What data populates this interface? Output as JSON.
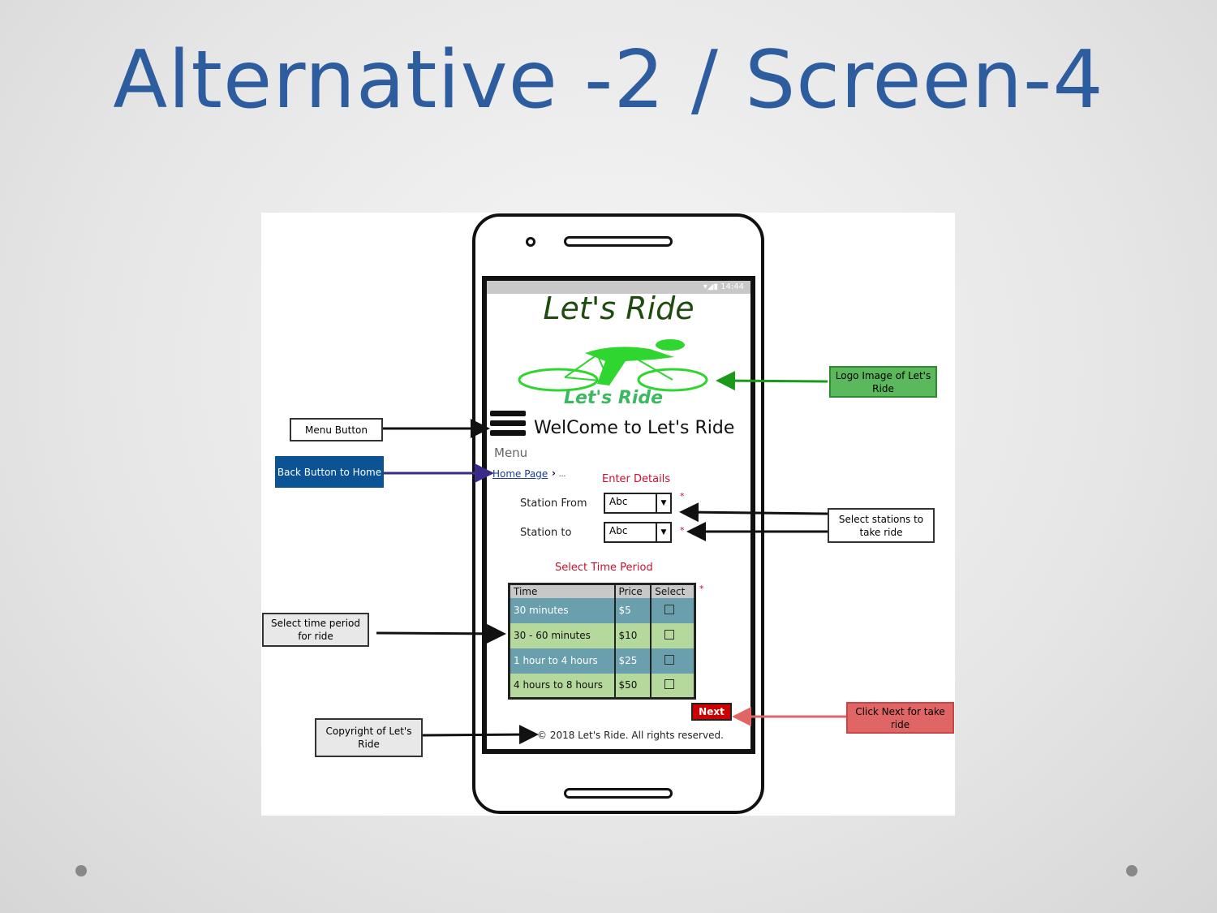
{
  "slide": {
    "title": "Alternative -2 / Screen-4"
  },
  "mockup": {
    "status_time": "14:44",
    "app_title": "Let's Ride",
    "logo_text": "Let's Ride",
    "welcome": "WelCome to Let's Ride",
    "menu_label": "Menu",
    "breadcrumb": {
      "home": "Home Page",
      "separator": "›",
      "ellipsis": "..."
    },
    "enter_details": "Enter Details",
    "station_from": {
      "label": "Station From",
      "value": "Abc"
    },
    "station_to": {
      "label": "Station to",
      "value": "Abc"
    },
    "required_mark": "*",
    "select_time_period": "Select Time Period",
    "table": {
      "headers": [
        "Time",
        "Price",
        "Select"
      ],
      "rows": [
        {
          "time": "30 minutes",
          "price": "$5"
        },
        {
          "time": "30 - 60 minutes",
          "price": "$10"
        },
        {
          "time": "1 hour to 4 hours",
          "price": "$25"
        },
        {
          "time": "4 hours to 8 hours",
          "price": "$50"
        }
      ]
    },
    "next": "Next",
    "copyright": "© 2018 Let's Ride. All rights reserved."
  },
  "annotations": {
    "menu_button": "Menu Button",
    "back_button": "Back Button to Home",
    "select_time": "Select time period for ride",
    "copyright": "Copyright of Let's Ride",
    "logo": "Logo Image of Let's Ride",
    "stations": "Select stations to take ride",
    "next": "Click Next for take ride"
  },
  "colors": {
    "title": "#2e5d9f",
    "back_note": "#0b5394",
    "logo_note": "#4caf50",
    "next_note": "#e06666",
    "next_button": "#cc0000",
    "required": "#c8102e"
  }
}
